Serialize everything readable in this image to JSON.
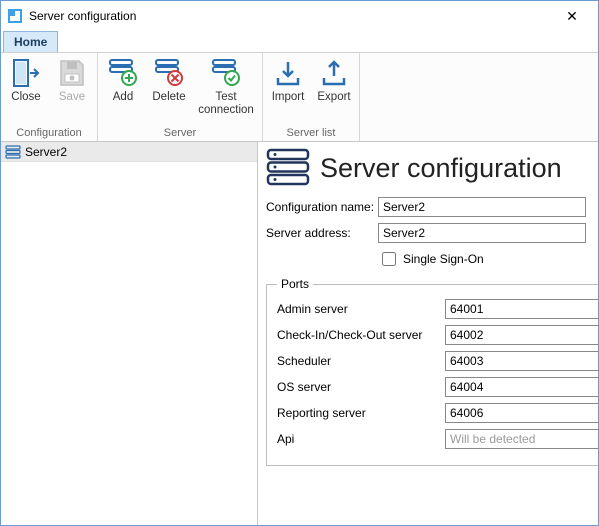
{
  "window": {
    "title": "Server configuration",
    "close_glyph": "✕"
  },
  "tabs": {
    "home": "Home"
  },
  "ribbon": {
    "configuration": {
      "label": "Configuration",
      "close": "Close",
      "save": "Save"
    },
    "server": {
      "label": "Server",
      "add": "Add",
      "delete": "Delete",
      "test": "Test connection"
    },
    "serverlist": {
      "label": "Server list",
      "import": "Import",
      "export": "Export"
    }
  },
  "tree": {
    "items": [
      {
        "label": "Server2"
      }
    ]
  },
  "main": {
    "heading": "Server configuration",
    "config_name_label": "Configuration name:",
    "config_name_value": "Server2",
    "server_address_label": "Server address:",
    "server_address_value": "Server2",
    "sso_label": "Single Sign-On",
    "ports_legend": "Ports",
    "ports": {
      "admin_label": "Admin server",
      "admin_value": "64001",
      "cico_label": "Check-In/Check-Out server",
      "cico_value": "64002",
      "scheduler_label": "Scheduler",
      "scheduler_value": "64003",
      "os_label": "OS server",
      "os_value": "64004",
      "reporting_label": "Reporting server",
      "reporting_value": "64006",
      "api_label": "Api",
      "api_placeholder": "Will be detected"
    }
  }
}
